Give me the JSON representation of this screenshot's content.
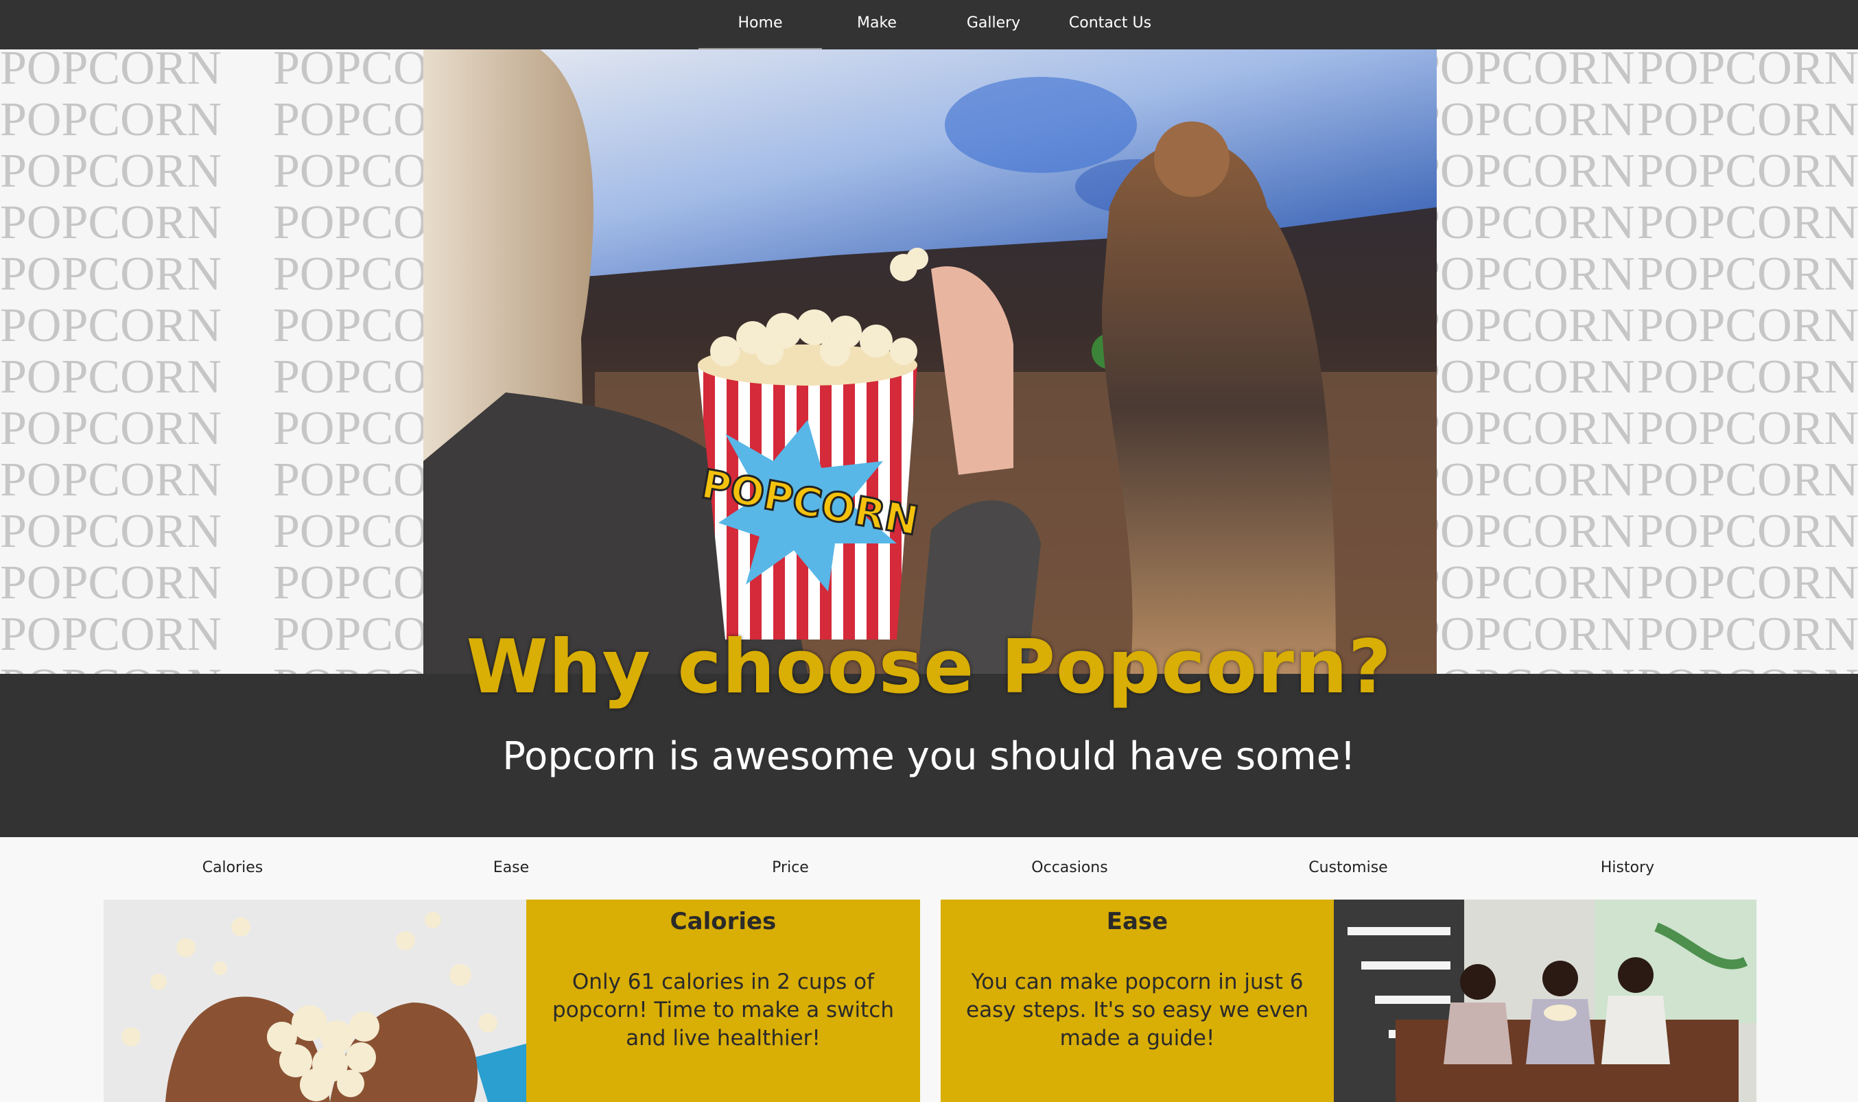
{
  "nav": {
    "items": [
      "Home",
      "Make",
      "Gallery",
      "Contact Us"
    ],
    "active": "Home"
  },
  "hero": {
    "pattern_word": "POPCORN",
    "bucket_label": "POPCORN",
    "headline": "Why choose Popcorn?",
    "subheadline": "Popcorn is awesome you should have some!"
  },
  "tabs": [
    "Calories",
    "Ease",
    "Price",
    "Occasions",
    "Customise",
    "History"
  ],
  "cards": {
    "calories": {
      "title": "Calories",
      "text": "Only 61 calories in 2 cups of popcorn! Time to make a switch and live healthier!"
    },
    "ease": {
      "title": "Ease",
      "text": "You can make popcorn in just 6 easy steps. It's so easy we even made a guide!"
    }
  },
  "colors": {
    "accent": "#d9ae05",
    "dark": "#333333",
    "light": "#f8f8f8"
  }
}
